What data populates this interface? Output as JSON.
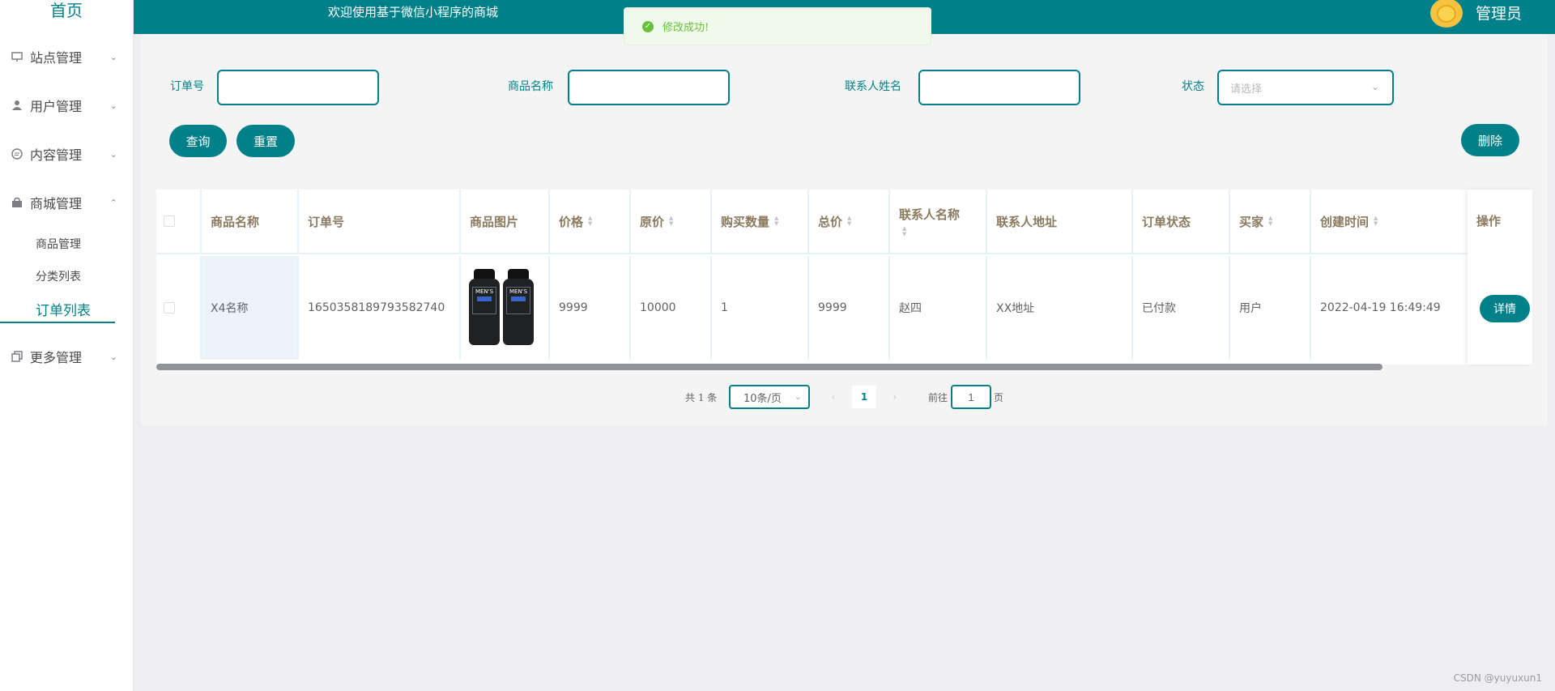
{
  "sidebar": {
    "home": "首页",
    "items": [
      {
        "label": "站点管理",
        "icon": "monitor-icon",
        "arrow": "⌄"
      },
      {
        "label": "用户管理",
        "icon": "user-icon",
        "arrow": "⌄"
      },
      {
        "label": "内容管理",
        "icon": "chat-icon",
        "arrow": "⌄"
      },
      {
        "label": "商城管理",
        "icon": "shopping-bag-icon",
        "arrow": "⌃"
      },
      {
        "label": "更多管理",
        "icon": "copy-icon",
        "arrow": "⌄"
      }
    ],
    "sub_items": [
      "商品管理",
      "分类列表",
      "订单列表"
    ]
  },
  "header": {
    "welcome": "欢迎使用基于微信小程序的商城",
    "admin": "管理员"
  },
  "toast": {
    "message": "修改成功!",
    "color": "#67c23a"
  },
  "search": {
    "order_no_label": "订单号",
    "product_name_label": "商品名称",
    "contact_name_label": "联系人姓名",
    "status_label": "状态",
    "status_placeholder": "请选择",
    "query_button": "查询",
    "reset_button": "重置",
    "delete_button": "删除"
  },
  "table": {
    "headers": {
      "product_name": "商品名称",
      "order_no": "订单号",
      "product_image": "商品图片",
      "price": "价格",
      "original_price": "原价",
      "quantity": "购买数量",
      "total": "总价",
      "contact_name": "联系人名称",
      "contact_address": "联系人地址",
      "order_status": "订单状态",
      "buyer": "买家",
      "created_at": "创建时间",
      "actions": "操作"
    },
    "rows": [
      {
        "product_name": "X4名称",
        "order_no": "1650358189793582740",
        "image_text": "MEN'S",
        "price": "9999",
        "original_price": "10000",
        "quantity": "1",
        "total": "9999",
        "contact_name": "赵四",
        "contact_address": "XX地址",
        "order_status": "已付款",
        "buyer": "用户",
        "created_at": "2022-04-19 16:49:49",
        "detail_button": "详情"
      }
    ]
  },
  "pagination": {
    "total": "共 1 条",
    "page_size": "10条/页",
    "current_page": "1",
    "goto_prefix": "前往",
    "goto_value": "1",
    "goto_suffix": "页"
  },
  "watermark": "CSDN @yuyuxun1",
  "colors": {
    "accent": "#00818a",
    "header_text": "#8a7a60"
  }
}
